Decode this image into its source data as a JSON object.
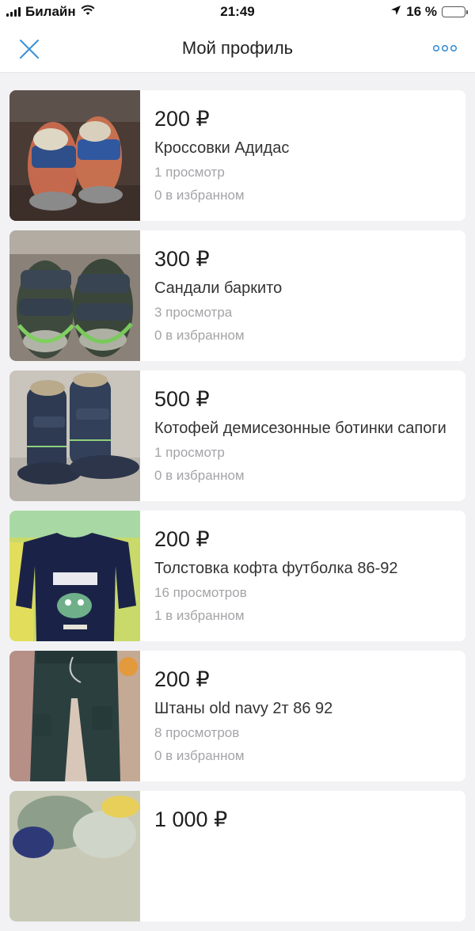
{
  "status_bar": {
    "carrier": "Билайн",
    "time": "21:49",
    "battery": "16 %",
    "battery_level": 0.16
  },
  "header": {
    "title": "Мой профиль",
    "close_icon": "close-icon",
    "more_icon": "more-dots-icon"
  },
  "listings": [
    {
      "price": "200 ₽",
      "title": "Кроссовки Адидас",
      "views": "1 просмотр",
      "favorites": "0 в избранном"
    },
    {
      "price": "300 ₽",
      "title": "Сандали баркито",
      "views": "3 просмотра",
      "favorites": "0 в избранном"
    },
    {
      "price": "500 ₽",
      "title": "Котофей демисезонные ботинки сапоги",
      "views": "1 просмотр",
      "favorites": "0 в избранном"
    },
    {
      "price": "200 ₽",
      "title": "Толстовка кофта футболка 86-92",
      "views": "16 просмотров",
      "favorites": "1 в избранном"
    },
    {
      "price": "200 ₽",
      "title": "Штаны old navy 2т 86 92",
      "views": "8 просмотров",
      "favorites": "0 в избранном"
    },
    {
      "price": "1 000 ₽",
      "title": "",
      "views": "",
      "favorites": ""
    }
  ],
  "colors": {
    "accent": "#3a8fd6",
    "background": "#f2f2f4",
    "meta_text": "#a4a4a8"
  }
}
